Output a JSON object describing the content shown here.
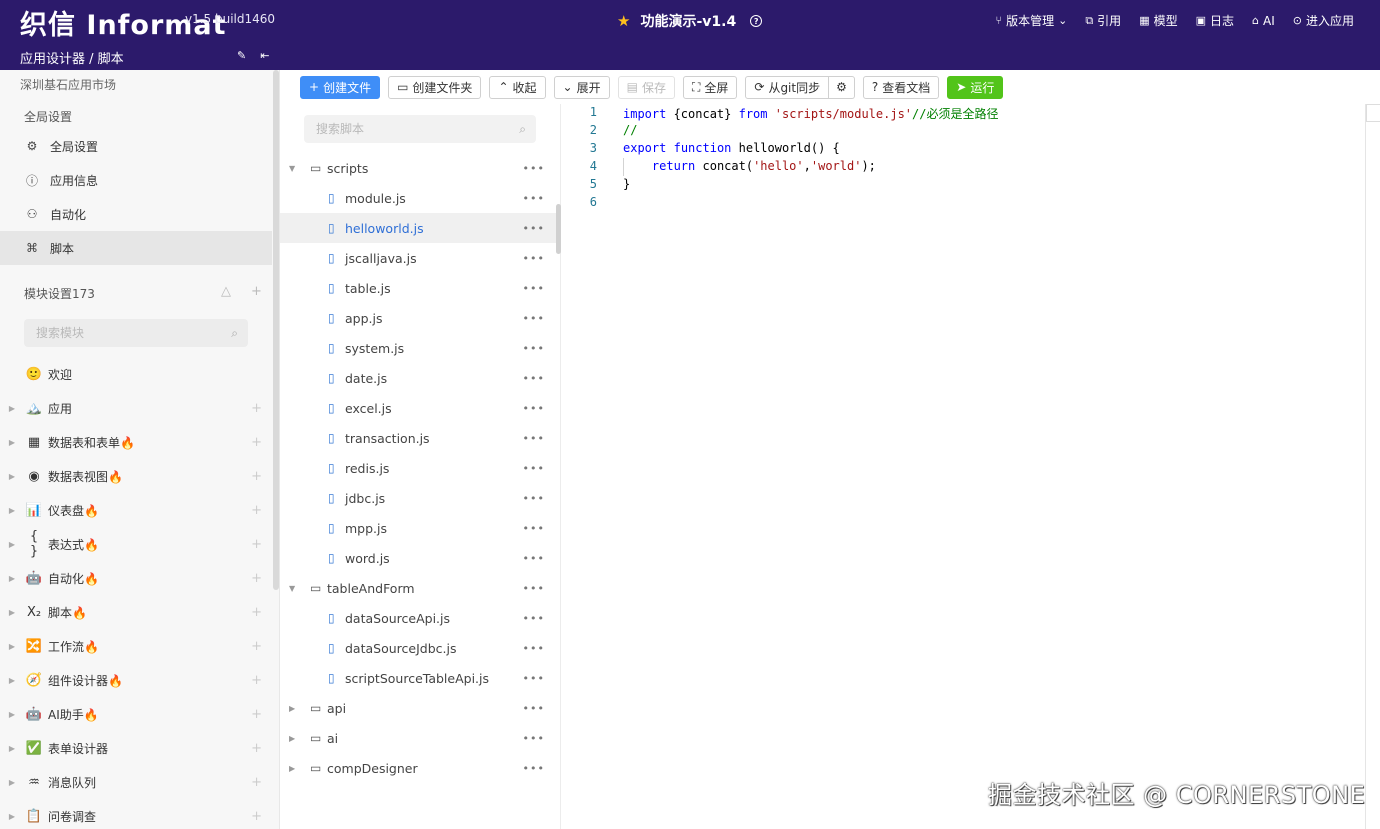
{
  "header": {
    "logo": "织信 Informat",
    "version": "v1.5 build1460",
    "app_title": "功能演示-v1.4",
    "help_icon": "?",
    "nav": [
      {
        "icon": "branch-icon",
        "label": "版本管理"
      },
      {
        "icon": "reference-icon",
        "label": "引用"
      },
      {
        "icon": "model-icon",
        "label": "模型"
      },
      {
        "icon": "log-icon",
        "label": "日志"
      },
      {
        "icon": "ai-icon",
        "label": "AI"
      },
      {
        "icon": "enter-icon",
        "label": "进入应用"
      }
    ]
  },
  "subbar": {
    "breadcrumb": "应用设计器 / 脚本"
  },
  "sidebar": {
    "market": "深圳基石应用市场",
    "global_title": "全局设置",
    "global_items": [
      {
        "icon": "gear-icon",
        "label": "全局设置"
      },
      {
        "icon": "info-icon",
        "label": "应用信息"
      },
      {
        "icon": "robot-icon",
        "label": "自动化"
      },
      {
        "icon": "script-icon",
        "label": "脚本"
      }
    ],
    "module_title": "模块设置173",
    "module_search_placeholder": "搜索模块",
    "modules": [
      {
        "emoji": "🙂",
        "label": "欢迎",
        "expandable": false
      },
      {
        "emoji": "🏔️",
        "label": "应用",
        "expandable": true
      },
      {
        "emoji": "▦",
        "label": "数据表和表单🔥",
        "expandable": true
      },
      {
        "emoji": "◉",
        "label": "数据表视图🔥",
        "expandable": true
      },
      {
        "emoji": "📊",
        "label": "仪表盘🔥",
        "expandable": true
      },
      {
        "emoji": "{ }",
        "label": "表达式🔥",
        "expandable": true
      },
      {
        "emoji": "🤖",
        "label": "自动化🔥",
        "expandable": true
      },
      {
        "emoji": "X₂",
        "label": "脚本🔥",
        "expandable": true
      },
      {
        "emoji": "🔀",
        "label": "工作流🔥",
        "expandable": true
      },
      {
        "emoji": "🧭",
        "label": "组件设计器🔥",
        "expandable": true
      },
      {
        "emoji": "🤖",
        "label": "AI助手🔥",
        "expandable": true
      },
      {
        "emoji": "✅",
        "label": "表单设计器",
        "expandable": true
      },
      {
        "emoji": "♒",
        "label": "消息队列",
        "expandable": true
      },
      {
        "emoji": "📋",
        "label": "问卷调查",
        "expandable": true
      }
    ]
  },
  "toolbar": {
    "create_file": "创建文件",
    "create_folder": "创建文件夹",
    "collapse": "收起",
    "expand": "展开",
    "save": "保存",
    "fullscreen": "全屏",
    "git_sync": "从git同步",
    "view_docs": "查看文档",
    "run": "运行"
  },
  "tree": {
    "search_placeholder": "搜索脚本",
    "nodes": [
      {
        "type": "folder",
        "label": "scripts",
        "level": 0,
        "open": true
      },
      {
        "type": "file",
        "label": "module.js",
        "level": 1
      },
      {
        "type": "file",
        "label": "helloworld.js",
        "level": 1,
        "active": true
      },
      {
        "type": "file",
        "label": "jscalljava.js",
        "level": 1
      },
      {
        "type": "file",
        "label": "table.js",
        "level": 1
      },
      {
        "type": "file",
        "label": "app.js",
        "level": 1
      },
      {
        "type": "file",
        "label": "system.js",
        "level": 1
      },
      {
        "type": "file",
        "label": "date.js",
        "level": 1
      },
      {
        "type": "file",
        "label": "excel.js",
        "level": 1
      },
      {
        "type": "file",
        "label": "transaction.js",
        "level": 1
      },
      {
        "type": "file",
        "label": "redis.js",
        "level": 1
      },
      {
        "type": "file",
        "label": "jdbc.js",
        "level": 1
      },
      {
        "type": "file",
        "label": "mpp.js",
        "level": 1
      },
      {
        "type": "file",
        "label": "word.js",
        "level": 1
      },
      {
        "type": "folder",
        "label": "tableAndForm",
        "level": 0,
        "open": true
      },
      {
        "type": "file",
        "label": "dataSourceApi.js",
        "level": 1
      },
      {
        "type": "file",
        "label": "dataSourceJdbc.js",
        "level": 1
      },
      {
        "type": "file",
        "label": "scriptSourceTableApi.js",
        "level": 1
      },
      {
        "type": "folder",
        "label": "api",
        "level": 0,
        "open": false
      },
      {
        "type": "folder",
        "label": "ai",
        "level": 0,
        "open": false
      },
      {
        "type": "folder",
        "label": "compDesigner",
        "level": 0,
        "open": false
      }
    ]
  },
  "editor": {
    "lines": [
      {
        "n": "1",
        "tokens": [
          [
            "kw",
            "import"
          ],
          [
            "p",
            " {concat} "
          ],
          [
            "kw",
            "from"
          ],
          [
            "p",
            " "
          ],
          [
            "str",
            "'scripts/module.js'"
          ],
          [
            "cmt",
            "//必须是全路径"
          ]
        ]
      },
      {
        "n": "2",
        "tokens": [
          [
            "cmt",
            "//"
          ]
        ]
      },
      {
        "n": "3",
        "tokens": [
          [
            "kw",
            "export"
          ],
          [
            "p",
            " "
          ],
          [
            "kw",
            "function"
          ],
          [
            "p",
            " helloworld() {"
          ]
        ]
      },
      {
        "n": "4",
        "tokens": [
          [
            "p",
            "    "
          ],
          [
            "kw",
            "return"
          ],
          [
            "p",
            " concat("
          ],
          [
            "str",
            "'hello'"
          ],
          [
            "p",
            ","
          ],
          [
            "str",
            "'world'"
          ],
          [
            "p",
            ");"
          ]
        ]
      },
      {
        "n": "5",
        "tokens": [
          [
            "p",
            "}"
          ]
        ]
      },
      {
        "n": "6",
        "tokens": []
      }
    ]
  },
  "watermark": "掘金技术社区 @ CORNERSTONE",
  "colors": {
    "header_bg": "#2c1a6b",
    "primary": "#3f8ef7",
    "run": "#52c41a",
    "active_file": "#2f6fd6"
  }
}
